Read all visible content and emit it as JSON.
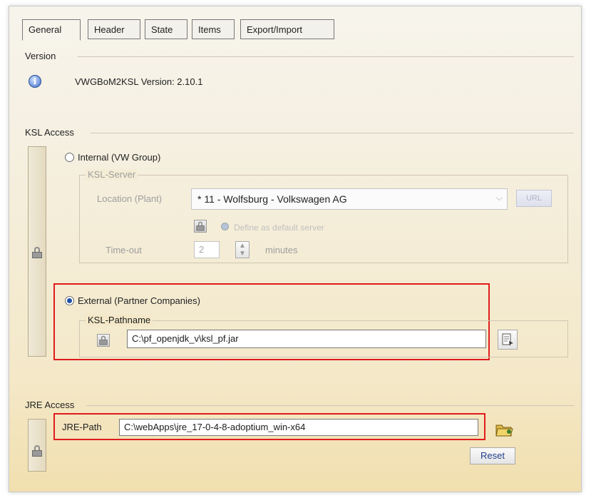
{
  "tabs": [
    {
      "label": "General",
      "active": true
    },
    {
      "label": "Header",
      "active": false
    },
    {
      "label": "State",
      "active": false
    },
    {
      "label": "Items",
      "active": false
    },
    {
      "label": "Export/Import",
      "active": false
    }
  ],
  "version": {
    "section_title": "Version",
    "text": "VWGBoM2KSL Version: 2.10.1"
  },
  "ksl_access": {
    "section_title": "KSL Access",
    "internal_label": "Internal (VW Group)",
    "internal_selected": false,
    "ksl_server": {
      "group_label": "KSL-Server",
      "location_label": "Location (Plant)",
      "location_value": "* 11 - Wolfsburg - Volkswagen AG",
      "url_button": "URL",
      "default_server_label": "Define as default server",
      "timeout_label": "Time-out",
      "timeout_value": "2",
      "timeout_unit": "minutes"
    },
    "external_label": "External (Partner Companies)",
    "external_selected": true,
    "ksl_pathname": {
      "group_label": "KSL-Pathname",
      "value": "C:\\pf_openjdk_v\\ksl_pf.jar"
    }
  },
  "jre_access": {
    "section_title": "JRE Access",
    "path_label": "JRE-Path",
    "path_value": "C:\\webApps\\jre_17-0-4-8-adoptium_win-x64",
    "reset_button": "Reset"
  },
  "colors": {
    "highlight_border": "#e01c1c",
    "radio_selected": "#1f4ea6"
  }
}
